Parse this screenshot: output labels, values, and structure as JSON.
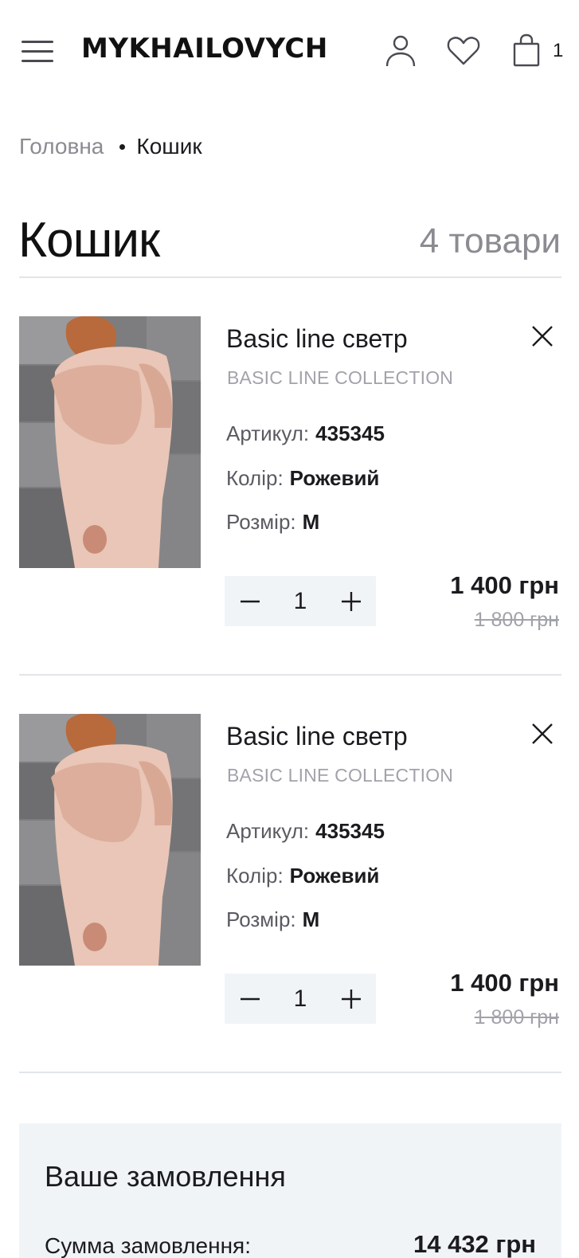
{
  "header": {
    "logo": "MYKHAILOVYCH",
    "cart_count": "1"
  },
  "breadcrumb": {
    "home": "Головна",
    "current": "Кошик"
  },
  "page": {
    "title": "Кошик",
    "items_count": "4 товари"
  },
  "labels": {
    "article": "Артикул:",
    "color": "Колір:",
    "size": "Розмір:"
  },
  "items": [
    {
      "name": "Basic line светр",
      "collection": "BASIC LINE COLLECTION",
      "article": "435345",
      "color": "Рожевий",
      "size": "M",
      "quantity": "1",
      "price": "1 400 грн",
      "old_price": "1 800 грн"
    },
    {
      "name": "Basic line светр",
      "collection": "BASIC LINE COLLECTION",
      "article": "435345",
      "color": "Рожевий",
      "size": "M",
      "quantity": "1",
      "price": "1 400 грн",
      "old_price": "1 800 грн"
    }
  ],
  "summary": {
    "title": "Ваше замовлення",
    "subtotal_label": "Сумма замовлення:",
    "subtotal_value": "14 432 грн"
  },
  "colors": {
    "accent_bg": "#f1f4f7",
    "muted_text": "#8b8b92",
    "divider": "#e2e4e8"
  },
  "icons": [
    "menu-icon",
    "user-icon",
    "heart-icon",
    "bag-icon",
    "close-icon",
    "minus-icon",
    "plus-icon"
  ]
}
